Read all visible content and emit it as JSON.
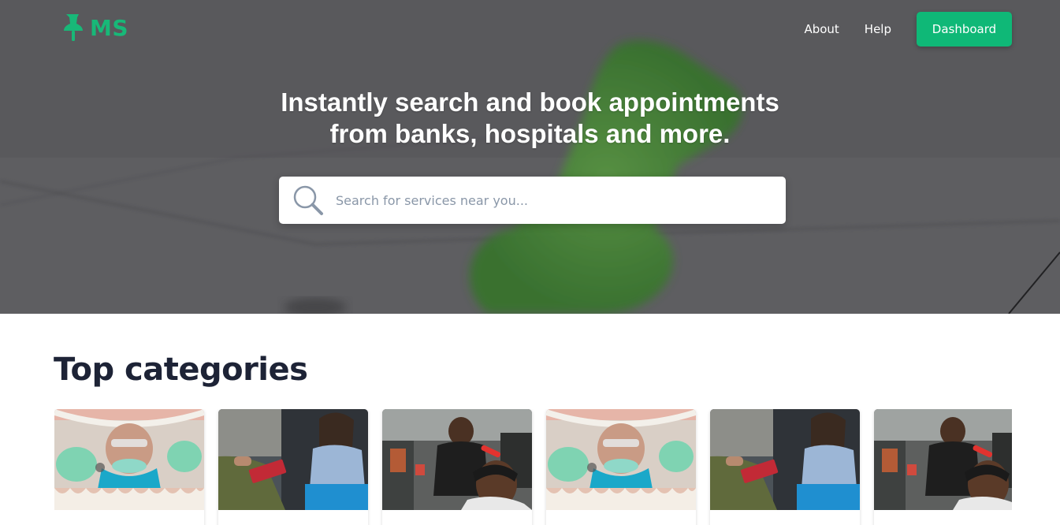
{
  "header": {
    "logo_text": "MS",
    "logo_icon": "pushpin-icon",
    "nav": [
      {
        "label": "About"
      },
      {
        "label": "Help"
      }
    ],
    "dashboard_label": "Dashboard"
  },
  "hero": {
    "headline_line1": "Instantly search and book appointments",
    "headline_line2": "from banks, hospitals and more."
  },
  "search": {
    "placeholder": "Search for services near you...",
    "icon": "search-icon"
  },
  "categories": {
    "title": "Top categories",
    "items": [
      {
        "image": "dentist-photo"
      },
      {
        "image": "therapist-photo"
      },
      {
        "image": "barber-photo"
      },
      {
        "image": "dentist-photo"
      },
      {
        "image": "therapist-photo"
      },
      {
        "image": "barber-photo"
      }
    ]
  },
  "colors": {
    "brand": "#18b878",
    "button": "#0fb877",
    "heading": "#1d2336",
    "placeholder": "#8a97a8"
  }
}
